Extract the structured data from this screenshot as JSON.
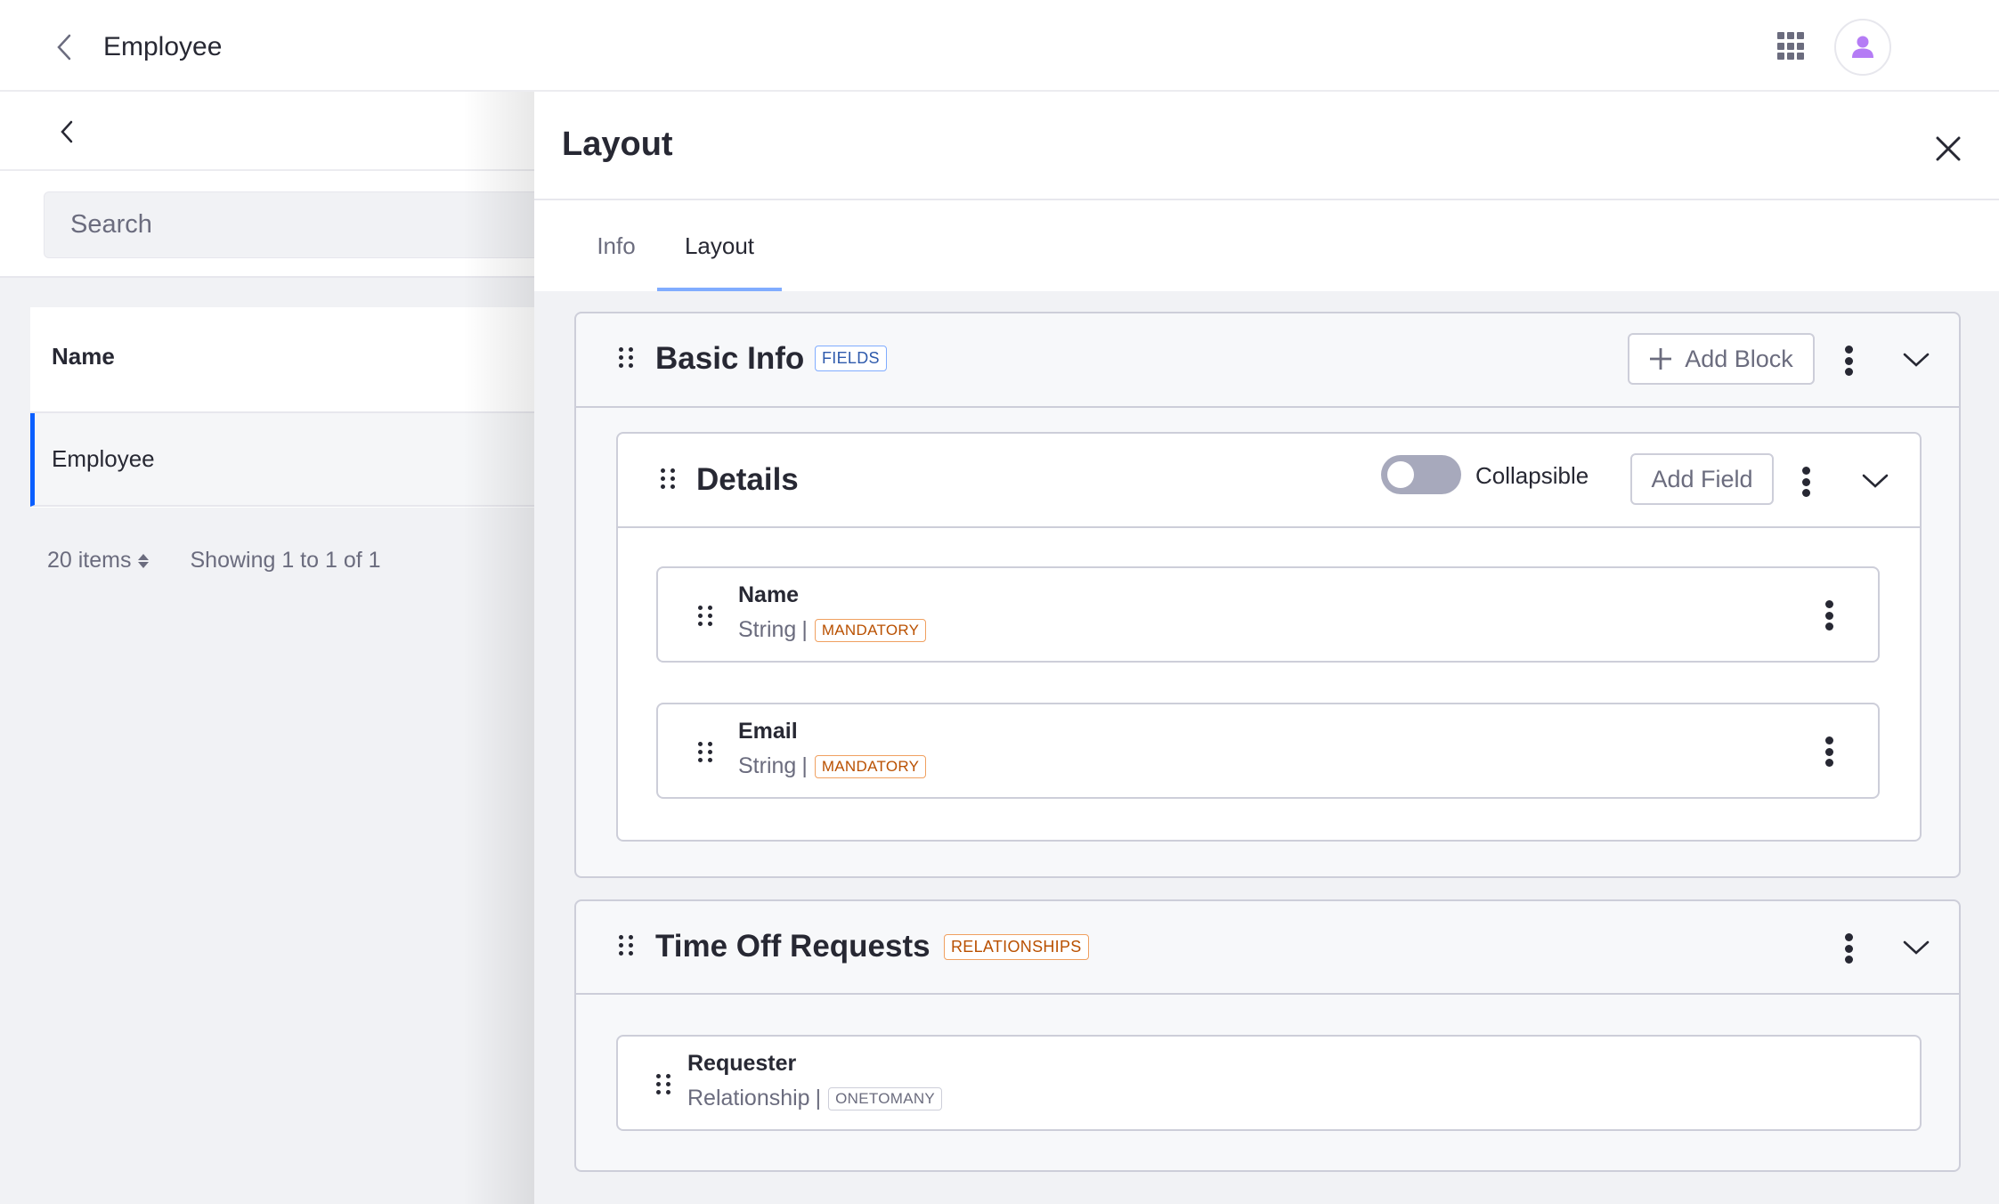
{
  "app": {
    "title": "Employee",
    "icons": {
      "back": "chevron-left-icon",
      "apps": "apps-grid-icon",
      "user": "user-avatar-icon"
    }
  },
  "list": {
    "search": {
      "placeholder": "Search",
      "value": ""
    },
    "columns": [
      "Name"
    ],
    "rows": [
      {
        "name": "Employee",
        "selected": true
      }
    ],
    "pagination": {
      "items_per_page": "20 items",
      "summary": "Showing 1 to 1 of 1"
    }
  },
  "panel": {
    "title": "Layout",
    "tabs": [
      {
        "label": "Info",
        "active": false
      },
      {
        "label": "Layout",
        "active": true
      }
    ],
    "tabs_blocks": [
      {
        "title": "Basic Info",
        "badge": "FIELDS",
        "add_button": "Add Block",
        "blocks": [
          {
            "title": "Details",
            "collapsible_label": "Collapsible",
            "collapsible": false,
            "add_button": "Add Field",
            "fields": [
              {
                "name": "Name",
                "type": "String",
                "separator": "|",
                "badge": "MANDATORY"
              },
              {
                "name": "Email",
                "type": "String",
                "separator": "|",
                "badge": "MANDATORY"
              }
            ]
          }
        ]
      },
      {
        "title": "Time Off Requests",
        "badge": "RELATIONSHIPS",
        "relationships": [
          {
            "name": "Requester",
            "type": "Relationship",
            "separator": "|",
            "badge": "ONETOMANY"
          }
        ]
      }
    ]
  },
  "colors": {
    "accent": "#0b5fff",
    "tab_underline": "#80acff",
    "fields_badge": "#2e5aac",
    "mandatory_badge": "#b95000",
    "avatar": "#b57cf5",
    "toggle_off": "#a7a9bc"
  }
}
